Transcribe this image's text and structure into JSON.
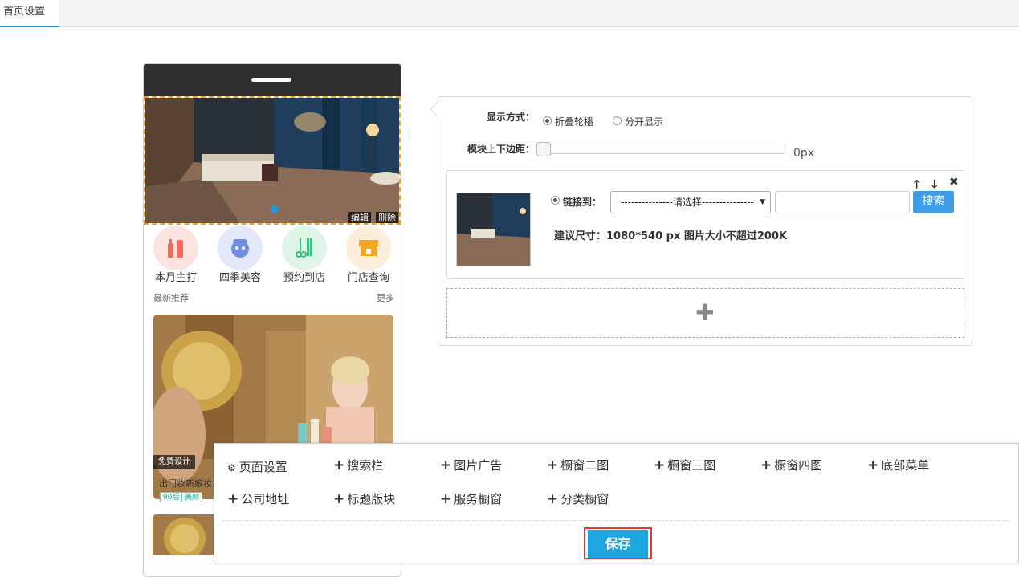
{
  "tabs": [
    {
      "label": "首页设置",
      "active": true
    }
  ],
  "phone": {
    "banner": {
      "edit_label": "编辑",
      "delete_label": "删除"
    },
    "icons": [
      {
        "label": "本月主打",
        "icon": "makeup-icon",
        "color": "#f26b5b"
      },
      {
        "label": "四季美容",
        "icon": "face-mask-icon",
        "color": "#6f8ee0"
      },
      {
        "label": "预约到店",
        "icon": "scissors-comb-icon",
        "color": "#3cbf7a"
      },
      {
        "label": "门店查询",
        "icon": "store-icon",
        "color": "#f5a623"
      }
    ],
    "section": {
      "title": "最新推荐",
      "more": "更多"
    },
    "card": {
      "tag": "免费设计",
      "title": "出门妆新娘妆",
      "badges": [
        "90后",
        "美颜"
      ]
    }
  },
  "panel": {
    "display_label": "显示方式：",
    "display_options": [
      {
        "label": "折叠轮播",
        "selected": true
      },
      {
        "label": "分开显示",
        "selected": false
      }
    ],
    "margin_label": "模块上下边距：",
    "margin_value": "0px",
    "item": {
      "link_label": "链接到：",
      "select_value": "---------------请选择---------------",
      "search_button": "搜索",
      "hint": "建议尺寸：1080*540 px 图片大小不超过200K",
      "controls": [
        "up-arrow-icon",
        "down-arrow-icon",
        "close-icon"
      ]
    }
  },
  "toolbar": {
    "row1": [
      "页面设置",
      "搜索栏",
      "图片广告",
      "橱窗二图",
      "橱窗三图",
      "橱窗四图",
      "底部菜单"
    ],
    "row2": [
      "公司地址",
      "标题版块",
      "服务橱窗",
      "分类橱窗"
    ],
    "save_label": "保存"
  },
  "colors": {
    "accent": "#1e9ad6",
    "save": "#1da6e0",
    "highlight": "#e53935",
    "banner_border": "#f0a12a"
  }
}
